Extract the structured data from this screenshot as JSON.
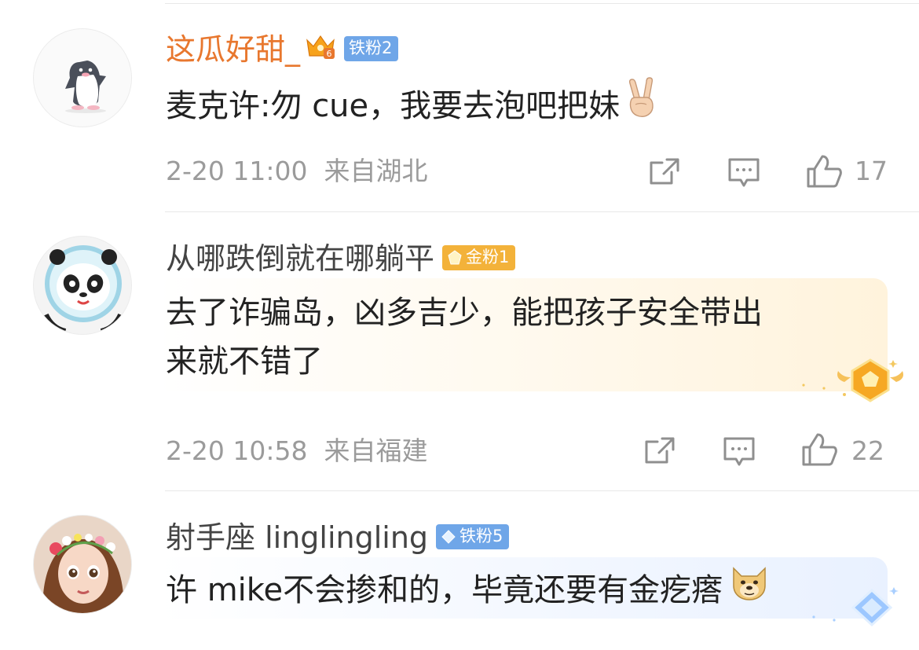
{
  "colors": {
    "username_highlight": "#e8772e",
    "username_default": "#444444",
    "badge_iron": "#6fa6e8",
    "badge_gold": "#f3b23a",
    "meta_gray": "#9b9b9b"
  },
  "comments": [
    {
      "username": "这瓜好甜_",
      "badge_label": "铁粉2",
      "text_lines": [
        "麦克许:勿 cue，我要去泡吧把妹"
      ],
      "text_emoji": "✌🏻",
      "date": "2-20 11:00",
      "location": "来自湖北",
      "likes": "17"
    },
    {
      "username": "从哪跌倒就在哪躺平",
      "badge_label": "金粉1",
      "text_lines": [
        "去了诈骗岛，凶多吉少，能把孩子安全带出",
        "来就不错了"
      ],
      "date": "2-20 10:58",
      "location": "来自福建",
      "likes": "22"
    },
    {
      "username": "射手座 linglingling",
      "badge_label": "铁粉5",
      "text_lines": [
        "许 mike不会掺和的，毕竟还要有金疙瘩"
      ],
      "text_emoji": "doge",
      "date": "",
      "location": "",
      "likes": ""
    }
  ]
}
